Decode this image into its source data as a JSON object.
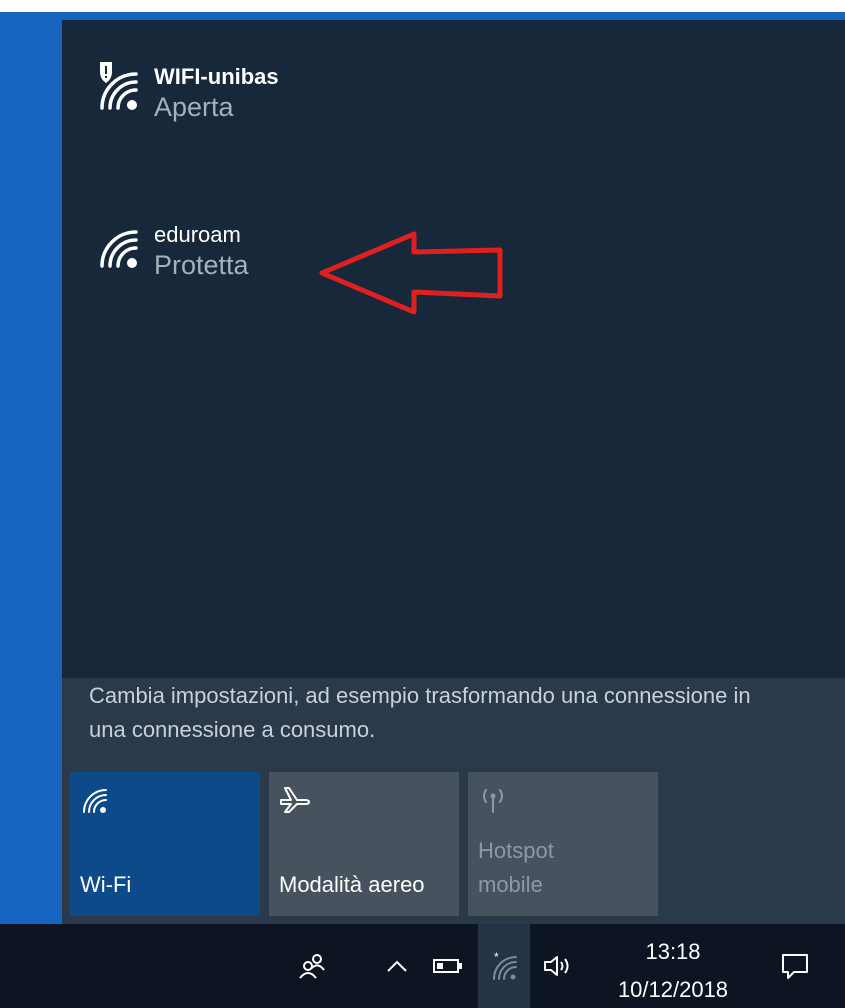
{
  "networks": [
    {
      "name": "WIFI-unibas",
      "status": "Aperta",
      "secured_warning": true
    },
    {
      "name": "eduroam",
      "status": "Protetta",
      "secured_warning": false
    }
  ],
  "settings_hint": "Cambia impostazioni, ad esempio trasformando una connessione in una connessione a consumo.",
  "quick_actions": [
    {
      "label": "Wi-Fi",
      "icon": "wifi-icon",
      "state": "on"
    },
    {
      "label": "Modalità aereo",
      "icon": "airplane-icon",
      "state": "off"
    },
    {
      "label": "Hotspot mobile",
      "icon": "hotspot-icon",
      "state": "disabled"
    }
  ],
  "taskbar": {
    "time": "13:18",
    "date": "10/12/2018",
    "icons": [
      "people-icon",
      "chevron-up-icon",
      "battery-icon",
      "wifi-icon",
      "volume-icon",
      "action-center-icon"
    ]
  },
  "annotation": {
    "type": "red-arrow",
    "points_to": "eduroam"
  },
  "colors": {
    "desktop_blue": "#1565c0",
    "flyout_bg": "#17283a",
    "wifi_tile_active": "#0d4a8a",
    "tile_inactive": "#46525e",
    "taskbar_bg": "#0c1521",
    "arrow_red": "#e02020"
  }
}
